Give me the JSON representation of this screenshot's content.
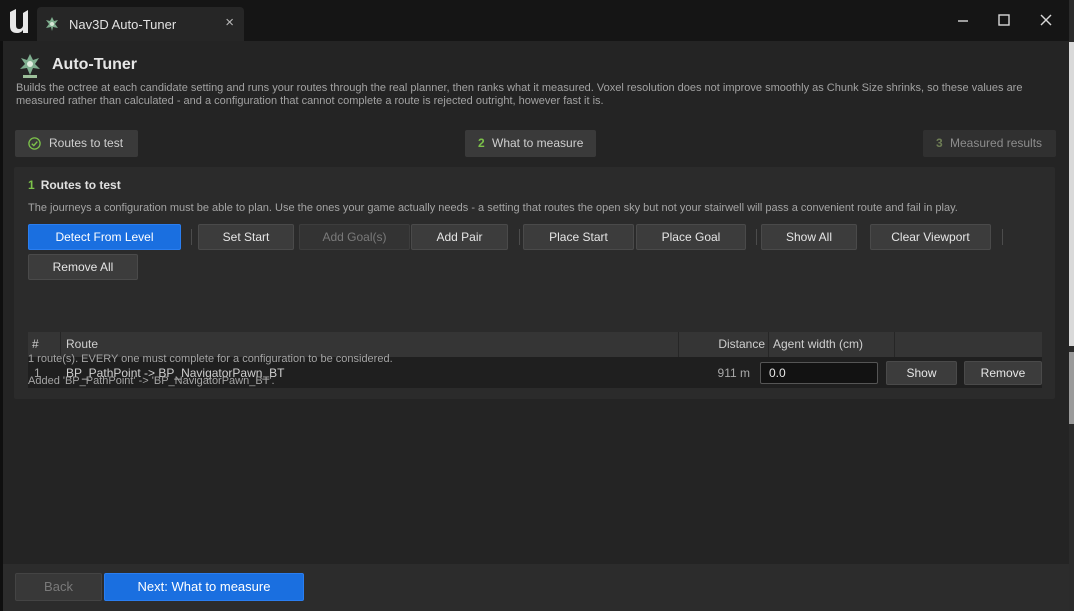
{
  "window": {
    "tab_title": "Nav3D Auto-Tuner",
    "close_glyph": "×"
  },
  "header": {
    "title": "Auto-Tuner",
    "description": "Builds the octree at each candidate setting and runs your routes through the real planner, then ranks what it measured. Voxel resolution does not improve smoothly as Chunk Size shrinks, so these values are measured rather than calculated - and a configuration that cannot complete a route is rejected outright, however fast it is."
  },
  "steps": [
    {
      "num": "",
      "label": "Routes to test",
      "state": "complete"
    },
    {
      "num": "2",
      "label": "What to measure",
      "state": "current"
    },
    {
      "num": "3",
      "label": "Measured results",
      "state": "pending"
    }
  ],
  "panel": {
    "num": "1",
    "title": "Routes to test",
    "description": "The journeys a configuration must be able to plan. Use the ones your game actually needs - a setting that routes the open sky but not your stairwell will pass a convenient route and fail in play."
  },
  "toolbar": {
    "detect": "Detect From Level",
    "set_start": "Set Start",
    "add_goals": "Add Goal(s)",
    "add_pair": "Add Pair",
    "place_start": "Place Start",
    "place_goal": "Place Goal",
    "show_all": "Show All",
    "clear_viewport": "Clear Viewport",
    "remove_all": "Remove All"
  },
  "table": {
    "headers": {
      "num": "#",
      "route": "Route",
      "distance": "Distance",
      "agent_width": "Agent width (cm)"
    },
    "rows": [
      {
        "num": "1",
        "route": "BP_PathPoint -> BP_NavigatorPawn_BT",
        "distance": "911 m",
        "agent_width": "0.0",
        "show": "Show",
        "remove": "Remove"
      }
    ]
  },
  "notes": {
    "count": "1 route(s). EVERY one must complete for a configuration to be considered.",
    "added": "Added 'BP_PathPoint' -> 'BP_NavigatorPawn_BT'."
  },
  "footer": {
    "back": "Back",
    "next": "Next:  What to measure"
  },
  "colors": {
    "accent_blue": "#1a6fe0",
    "step_green": "#7cc24a",
    "background": "#242424"
  },
  "icons": [
    "unreal-logo-icon",
    "nav3d-plugin-icon",
    "close-icon",
    "minimize-icon",
    "maximize-icon",
    "check-circle-icon"
  ]
}
